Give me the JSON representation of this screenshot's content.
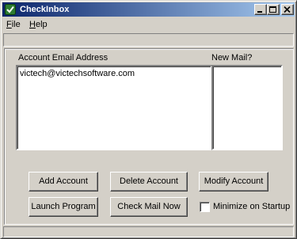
{
  "window": {
    "title": "CheckInbox",
    "icon": "checkmark-mail-icon"
  },
  "menu": {
    "file_prefix": "F",
    "file_rest": "ile",
    "help_prefix": "H",
    "help_rest": "elp"
  },
  "accounts": {
    "email_header": "Account Email Address",
    "newmail_header": "New Mail?",
    "rows": [
      {
        "email": "victech@victechsoftware.com",
        "new_mail": ""
      }
    ]
  },
  "buttons": {
    "add_account": "Add Account",
    "delete_account": "Delete Account",
    "modify_account": "Modify Account",
    "launch_program": "Launch Program",
    "check_mail_now": "Check Mail Now"
  },
  "options": {
    "minimize_on_startup_label": "Minimize on Startup",
    "minimize_on_startup_checked": false
  },
  "colors": {
    "titlebar_start": "#0a246a",
    "titlebar_end": "#a6caf0",
    "face": "#d4d0c8"
  }
}
